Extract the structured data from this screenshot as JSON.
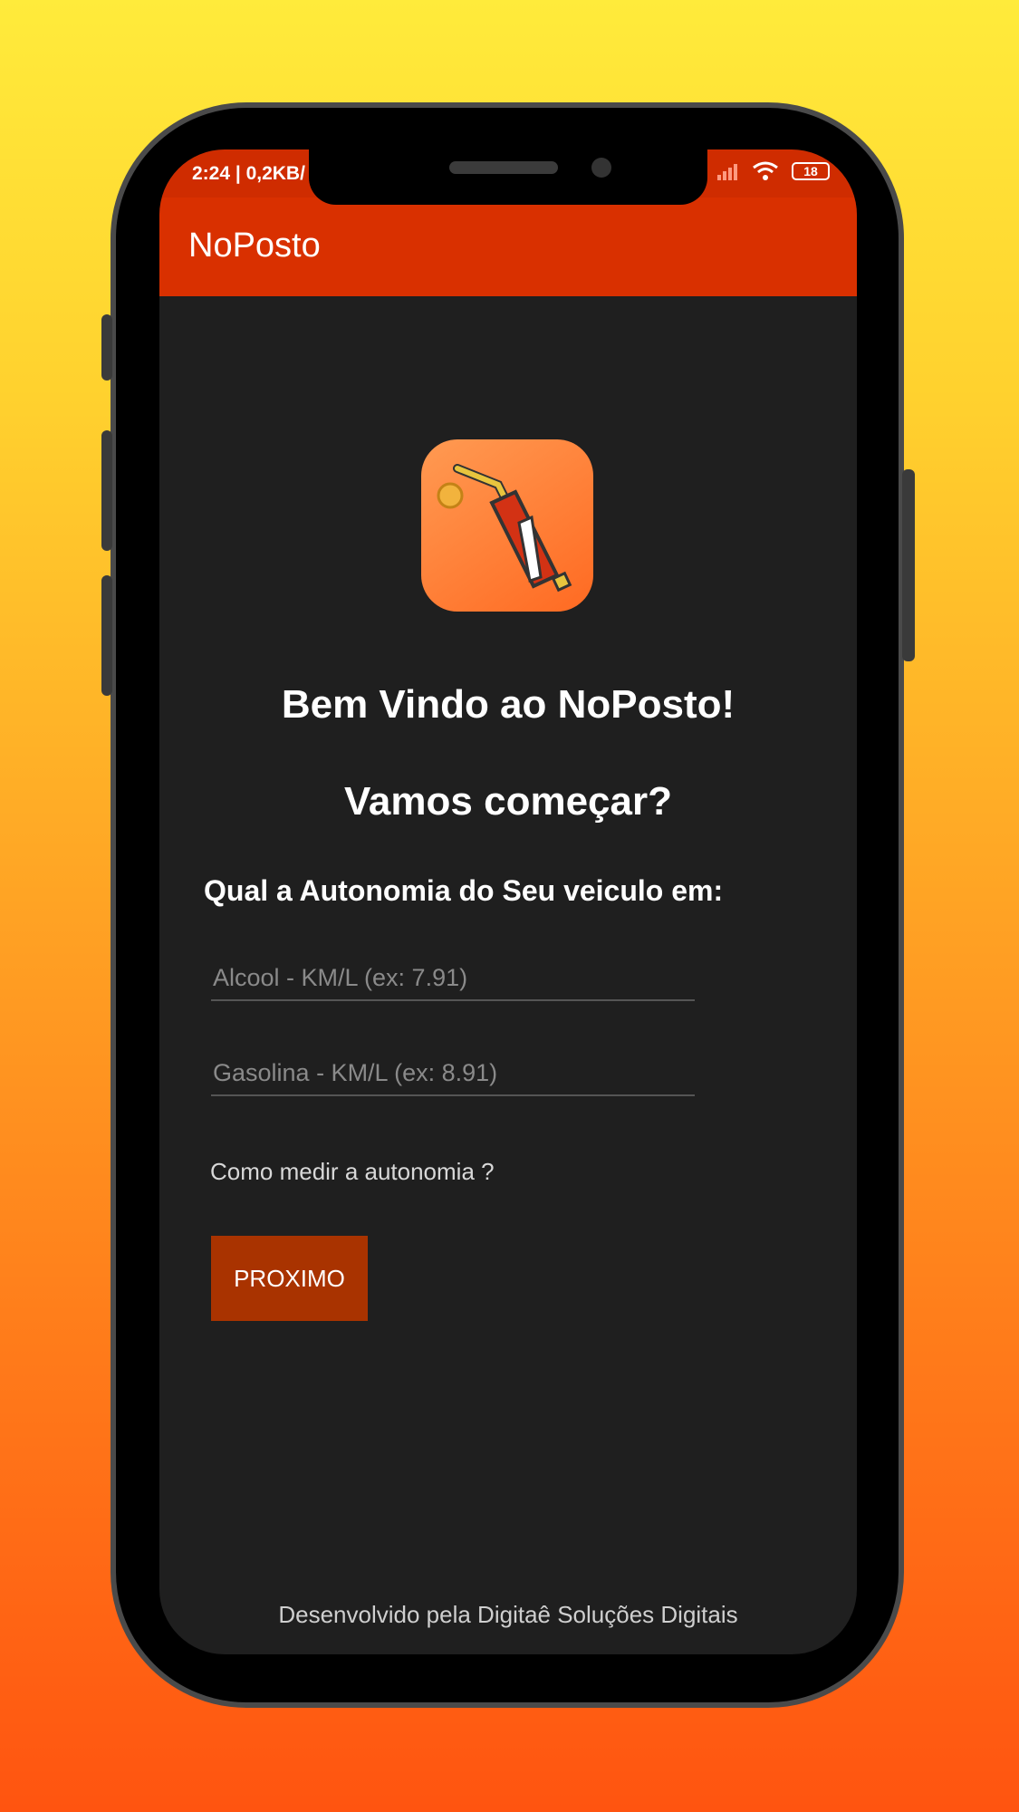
{
  "status_bar": {
    "time_and_speed": "2:24 | 0,2KB/",
    "battery": "18"
  },
  "app": {
    "title": "NoPosto"
  },
  "main": {
    "welcome": "Bem Vindo ao NoPosto!",
    "start": "Vamos começar?",
    "question": "Qual a Autonomia do Seu veiculo em:",
    "alcool_placeholder": "Alcool - KM/L (ex: 7.91)",
    "gasolina_placeholder": "Gasolina - KM/L (ex: 8.91)",
    "link_text": "Como medir a autonomia ?",
    "next_label": "PROXIMO"
  },
  "footer": {
    "text": "Desenvolvido pela Digitaê Soluções Digitais"
  },
  "colors": {
    "appbar": "#d93000",
    "button": "#a93300",
    "background": "#1f1f1f"
  },
  "icons": [
    "fuel-pump-icon",
    "coin-icon",
    "signal-icon",
    "wifi-icon",
    "battery-icon"
  ]
}
